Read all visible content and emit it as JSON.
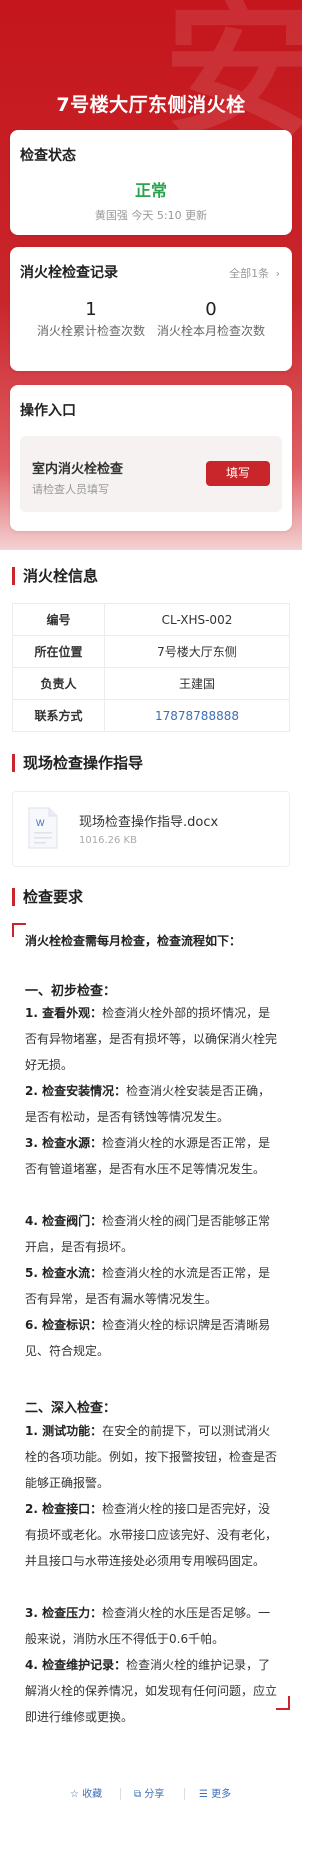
{
  "header": {
    "title": "7号楼大厅东侧消火栓",
    "watermark": "安"
  },
  "status_card": {
    "title": "检查状态",
    "status": "正常",
    "status_color": "#2aa54d",
    "meta": "黄国强 今天 5:10 更新"
  },
  "records_card": {
    "title": "消火栓检查记录",
    "all_link": "全部1条",
    "stats": [
      {
        "value": "1",
        "label": "消火栓累计检查次数"
      },
      {
        "value": "0",
        "label": "消火栓本月检查次数"
      }
    ]
  },
  "ops_card": {
    "title": "操作入口",
    "item_name": "室内消火栓检查",
    "item_sub": "请检查人员填写",
    "fill_button": "填写"
  },
  "info": {
    "title": "消火栓信息",
    "rows": [
      {
        "key": "编号",
        "value": "CL-XHS-002"
      },
      {
        "key": "所在位置",
        "value": "7号楼大厅东侧"
      },
      {
        "key": "负责人",
        "value": "王建国"
      },
      {
        "key": "联系方式",
        "value": "17878788888"
      }
    ]
  },
  "guide": {
    "title": "现场检查操作指导",
    "file_name": "现场检查操作指导.docx",
    "file_size": "1016.26 KB",
    "file_icon_letter": "W"
  },
  "requirements": {
    "title": "检查要求",
    "lead": "消火栓检查需每月检查，检查流程如下：",
    "section1_title": "一、初步检查：",
    "section1_items": [
      {
        "label": "1. 查看外观：",
        "text": "检查消火栓外部的损坏情况，是否有异物堵塞，是否有损坏等，以确保消火栓完好无损。"
      },
      {
        "label": "2. 检查安装情况：",
        "text": "检查消火栓安装是否正确，是否有松动，是否有锈蚀等情况发生。"
      },
      {
        "label": "3. 检查水源：",
        "text": "检查消火栓的水源是否正常，是否有管道堵塞，是否有水压不足等情况发生。"
      },
      {
        "label": "4. 检查阀门：",
        "text": "检查消火栓的阀门是否能够正常开启，是否有损坏。"
      },
      {
        "label": "5. 检查水流：",
        "text": "检查消火栓的水流是否正常，是否有异常，是否有漏水等情况发生。"
      },
      {
        "label": "6. 检查标识：",
        "text": "检查消火栓的标识牌是否清晰易见、符合规定。"
      }
    ],
    "section2_title": "二、深入检查：",
    "section2_items": [
      {
        "label": "1. 测试功能：",
        "text": "在安全的前提下，可以测试消火栓的各项功能。例如，按下报警按钮，检查是否能够正确报警。"
      },
      {
        "label": "2. 检查接口：",
        "text": "检查消火栓的接口是否完好，没有损坏或老化。水带接口应该完好、没有老化，并且接口与水带连接处必须用专用喉码固定。"
      },
      {
        "label": "3. 检查压力：",
        "text": "检查消火栓的水压是否足够。一般来说，消防水压不得低于0.6千帕。"
      },
      {
        "label": "4. 检查维护记录：",
        "text": "检查消火栓的维护记录，了解消火栓的保养情况，如发现有任何问题，应立即进行维修或更换。"
      }
    ]
  },
  "footer": {
    "favorite": "收藏",
    "share": "分享",
    "more": "更多"
  },
  "colors": {
    "brand_red": "#c9262c",
    "link_blue": "#3d6fb6",
    "status_green": "#2aa54d"
  }
}
